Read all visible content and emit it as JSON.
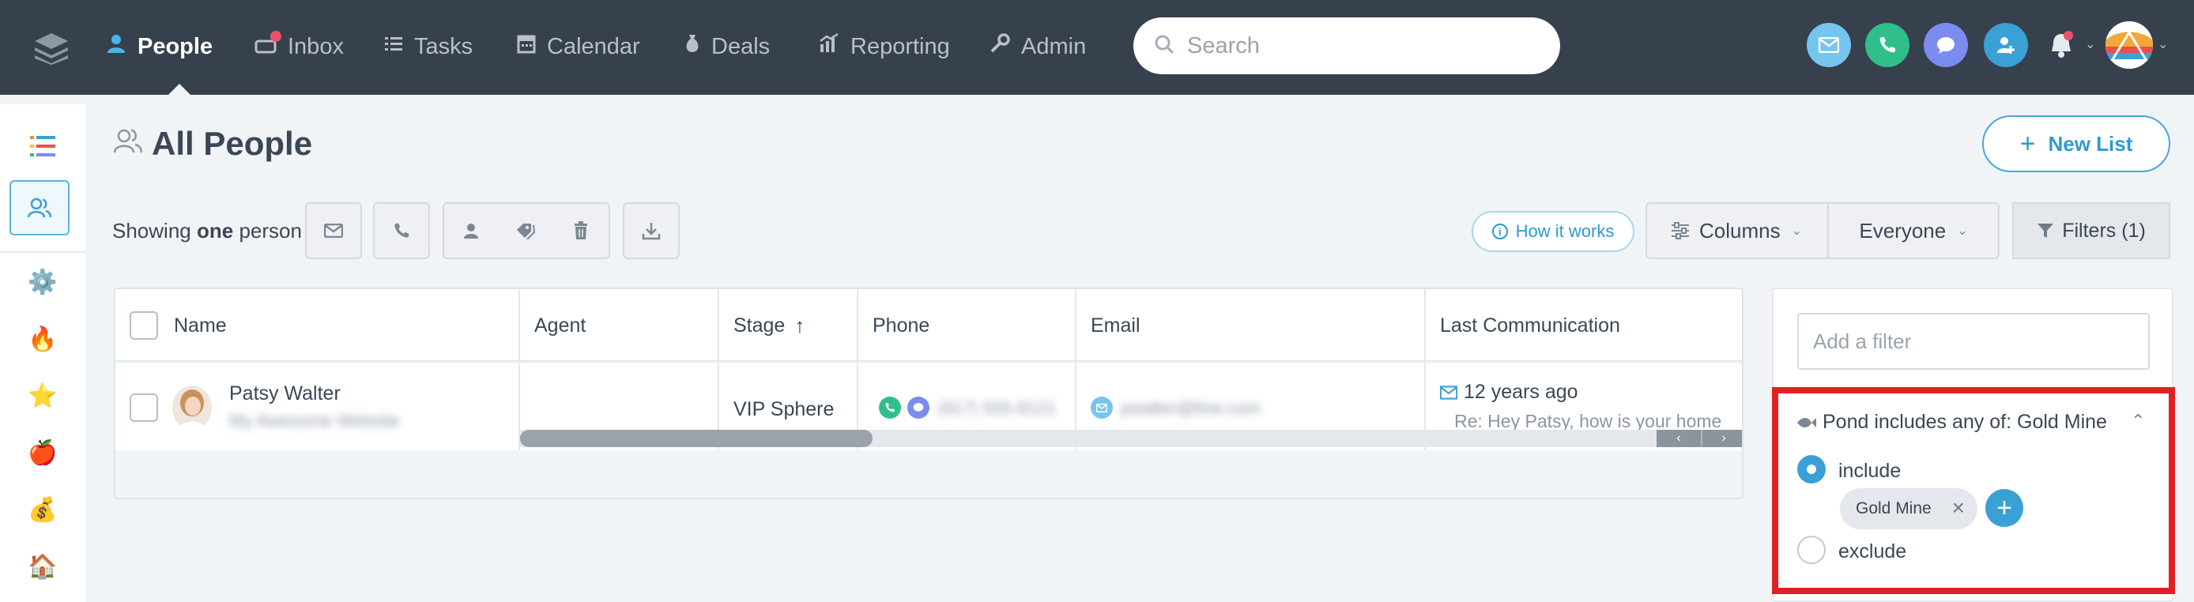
{
  "nav": {
    "items": [
      {
        "label": "People",
        "icon": "person-icon"
      },
      {
        "label": "Inbox",
        "icon": "inbox-icon"
      },
      {
        "label": "Tasks",
        "icon": "tasks-list-icon"
      },
      {
        "label": "Calendar",
        "icon": "calendar-icon"
      },
      {
        "label": "Deals",
        "icon": "money-bag-icon"
      },
      {
        "label": "Reporting",
        "icon": "chart-icon"
      },
      {
        "label": "Admin",
        "icon": "wrench-icon"
      }
    ],
    "active": "People",
    "search_placeholder": "Search",
    "right_icons": [
      "email-icon",
      "phone-icon",
      "chat-icon",
      "add-person-icon",
      "bell-icon",
      "user-avatar"
    ]
  },
  "sidebar": {
    "items": [
      "lists-icon",
      "people-icon",
      "gear-icon",
      "fire-icon",
      "star-icon",
      "apple-icon",
      "money-bag-icon",
      "house-icon"
    ]
  },
  "page": {
    "title": "All People",
    "new_list_label": "New List"
  },
  "toolbar": {
    "showing_prefix": "Showing",
    "showing_count": "one",
    "showing_suffix": "person",
    "how_it_works": "How it works",
    "columns_label": "Columns",
    "everyone_label": "Everyone",
    "filters_label": "Filters (1)"
  },
  "table": {
    "columns": [
      "Name",
      "Agent",
      "Stage",
      "Phone",
      "Email",
      "Last Communication"
    ],
    "rows": [
      {
        "name": "Patsy Walter",
        "subtitle": "My Awesome Website",
        "agent": "",
        "stage": "VIP Sphere",
        "phone": "(917) 555-8121",
        "email": "pwalter@fine.com",
        "last_comm_time": "12 years ago",
        "last_comm_preview": "Re: Hey Patsy, how is your home"
      }
    ]
  },
  "filter_panel": {
    "add_filter_placeholder": "Add a filter",
    "filter_title": "Pond includes any of: Gold Mine",
    "include_label": "include",
    "exclude_label": "exclude",
    "selected_mode": "include",
    "chips": [
      "Gold Mine"
    ]
  },
  "colors": {
    "nav_bg": "#36414d",
    "accent": "#3aa0d6",
    "highlight": "#e12121"
  }
}
